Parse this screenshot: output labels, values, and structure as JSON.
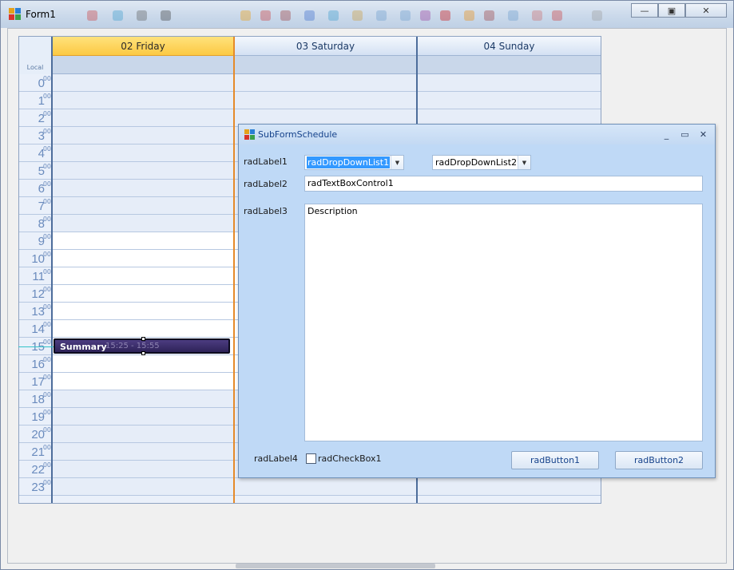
{
  "window": {
    "title": "Form1",
    "minimize_glyph": "—",
    "maximize_glyph": "▣",
    "close_glyph": "✕"
  },
  "scheduler": {
    "timezone_label": "Local",
    "days": [
      {
        "label": "02 Friday",
        "selected": true
      },
      {
        "label": "03 Saturday",
        "selected": false
      },
      {
        "label": "04 Sunday",
        "selected": false
      }
    ],
    "hours": [
      "0",
      "1",
      "2",
      "3",
      "4",
      "5",
      "6",
      "7",
      "8",
      "9",
      "10",
      "11",
      "12",
      "13",
      "14",
      "15",
      "16",
      "17",
      "18",
      "19",
      "20",
      "21",
      "22",
      "23"
    ],
    "minutes_suffix": "00",
    "work_hours": [
      9,
      10,
      11,
      12,
      13,
      14,
      15,
      16,
      17
    ],
    "appointment": {
      "summary": "Summary",
      "time": "15:25 - 15:55",
      "color": "#3b2e6b"
    }
  },
  "subform": {
    "title": "SubFormSchedule",
    "label1": "radLabel1",
    "label2": "radLabel2",
    "label3": "radLabel3",
    "label4": "radLabel4",
    "dropdown1": "radDropDownList1",
    "dropdown2": "radDropDownList2",
    "textbox": "radTextBoxControl1",
    "description": "Description",
    "checkbox_label": "radCheckBox1",
    "button1": "radButton1",
    "button2": "radButton2",
    "minimize_glyph": "_",
    "maximize_glyph": "▭",
    "close_glyph": "✕"
  },
  "colors": {
    "selected_day": "#fcc943",
    "selected_border": "#e58a2a",
    "accent": "#15428b"
  }
}
